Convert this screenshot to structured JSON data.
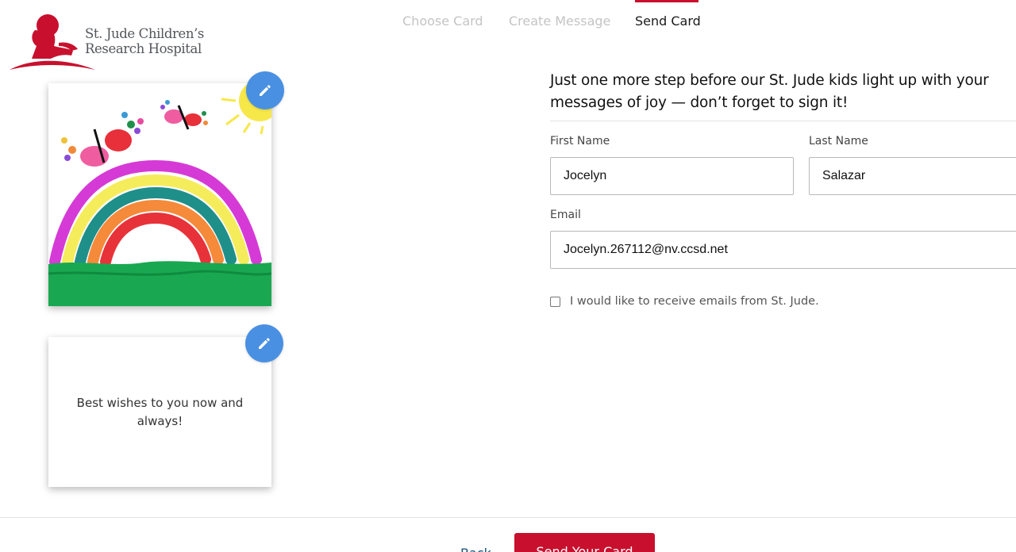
{
  "brand": {
    "line1": "St. Jude Children’s",
    "line2": "Research Hospital",
    "logo_icon": "child-silhouette-icon",
    "color": "#c8102e"
  },
  "steps": [
    {
      "label": "Choose Card",
      "state": "complete"
    },
    {
      "label": "Create Message",
      "state": "complete"
    },
    {
      "label": "Send Card",
      "state": "active"
    }
  ],
  "cards": {
    "front": {
      "artwork": "rainbow-butterflies-drawing",
      "edit_icon": "pencil-icon"
    },
    "back": {
      "message": "Best wishes to you now and always!",
      "edit_icon": "pencil-icon"
    }
  },
  "form": {
    "heading": "Just one more step before our St. Jude kids light up with your messages of joy — don’t forget to sign it!",
    "first_name": {
      "label": "First Name",
      "value": "Jocelyn"
    },
    "last_name": {
      "label": "Last Name",
      "value": "Salazar"
    },
    "email": {
      "label": "Email",
      "value": "Jocelyn.267112@nv.ccsd.net"
    },
    "opt_in": {
      "label": "I would like to receive emails from St. Jude.",
      "checked": false
    }
  },
  "footer": {
    "back_label": "Back",
    "send_label": "Send Your Card"
  },
  "colors": {
    "accent": "#c8102e",
    "edit_button": "#4a90e2",
    "inactive_step": "#c4c4c4"
  }
}
